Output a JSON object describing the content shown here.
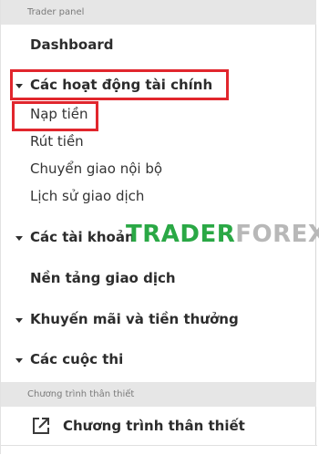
{
  "trader_panel": {
    "header": "Trader panel",
    "dashboard": "Dashboard",
    "financial": {
      "label": "Các hoạt động tài chính",
      "items": [
        "Nạp tiền",
        "Rút tiền",
        "Chuyển giao nội bộ",
        "Lịch sử giao dịch"
      ]
    },
    "accounts": "Các tài khoản",
    "platforms": "Nền tảng giao dịch",
    "promotions": "Khuyến mãi và tiền thưởng",
    "contests": "Các cuộc thi"
  },
  "loyalty": {
    "header": "Chương trình thân thiết",
    "link": "Chương trình thân thiết"
  },
  "watermark": {
    "part1": "TRADER",
    "part2": "FOREX"
  },
  "colors": {
    "highlight": "#e1262d",
    "watermark_green": "#2aa845",
    "header_bg": "#e6e6e6"
  },
  "icons": {
    "caret": "caret-down-icon",
    "external": "external-link-icon"
  }
}
